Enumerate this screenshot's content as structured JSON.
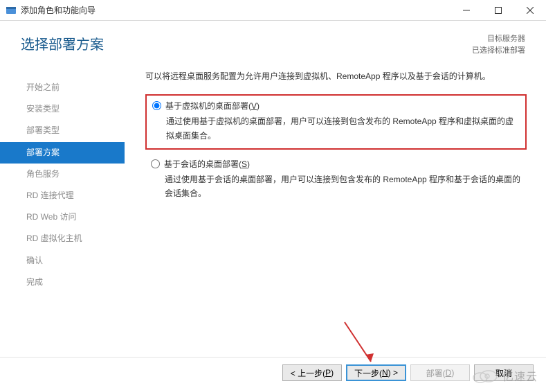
{
  "window": {
    "title": "添加角色和功能向导"
  },
  "header": {
    "title": "选择部署方案",
    "right_line1": "目标服务器",
    "right_line2": "已选择标准部署"
  },
  "sidebar": {
    "items": [
      {
        "label": "开始之前",
        "state": "disabled"
      },
      {
        "label": "安装类型",
        "state": "disabled"
      },
      {
        "label": "部署类型",
        "state": "disabled"
      },
      {
        "label": "部署方案",
        "state": "active"
      },
      {
        "label": "角色服务",
        "state": "disabled"
      },
      {
        "label": "RD 连接代理",
        "state": "disabled"
      },
      {
        "label": "RD Web 访问",
        "state": "disabled"
      },
      {
        "label": "RD 虚拟化主机",
        "state": "disabled"
      },
      {
        "label": "确认",
        "state": "disabled"
      },
      {
        "label": "完成",
        "state": "disabled"
      }
    ]
  },
  "content": {
    "intro": "可以将远程桌面服务配置为允许用户连接到虚拟机、RemoteApp 程序以及基于会话的计算机。",
    "option1": {
      "label_prefix": "基于虚拟机的桌面部署(",
      "label_shortcut": "V",
      "label_suffix": ")",
      "desc": "通过使用基于虚拟机的桌面部署，用户可以连接到包含发布的 RemoteApp 程序和虚拟桌面的虚拟桌面集合。",
      "checked": true
    },
    "option2": {
      "label_prefix": "基于会话的桌面部署(",
      "label_shortcut": "S",
      "label_suffix": ")",
      "desc": "通过使用基于会话的桌面部署，用户可以连接到包含发布的 RemoteApp 程序和基于会话的桌面的会话集合。",
      "checked": false
    }
  },
  "footer": {
    "prev_prefix": "< 上一步(",
    "prev_shortcut": "P",
    "prev_suffix": ")",
    "next_prefix": "下一步(",
    "next_shortcut": "N",
    "next_suffix": ") >",
    "deploy_prefix": "部署(",
    "deploy_shortcut": "D",
    "deploy_suffix": ")",
    "cancel": "取消"
  },
  "watermark": {
    "text": "亿速云"
  }
}
